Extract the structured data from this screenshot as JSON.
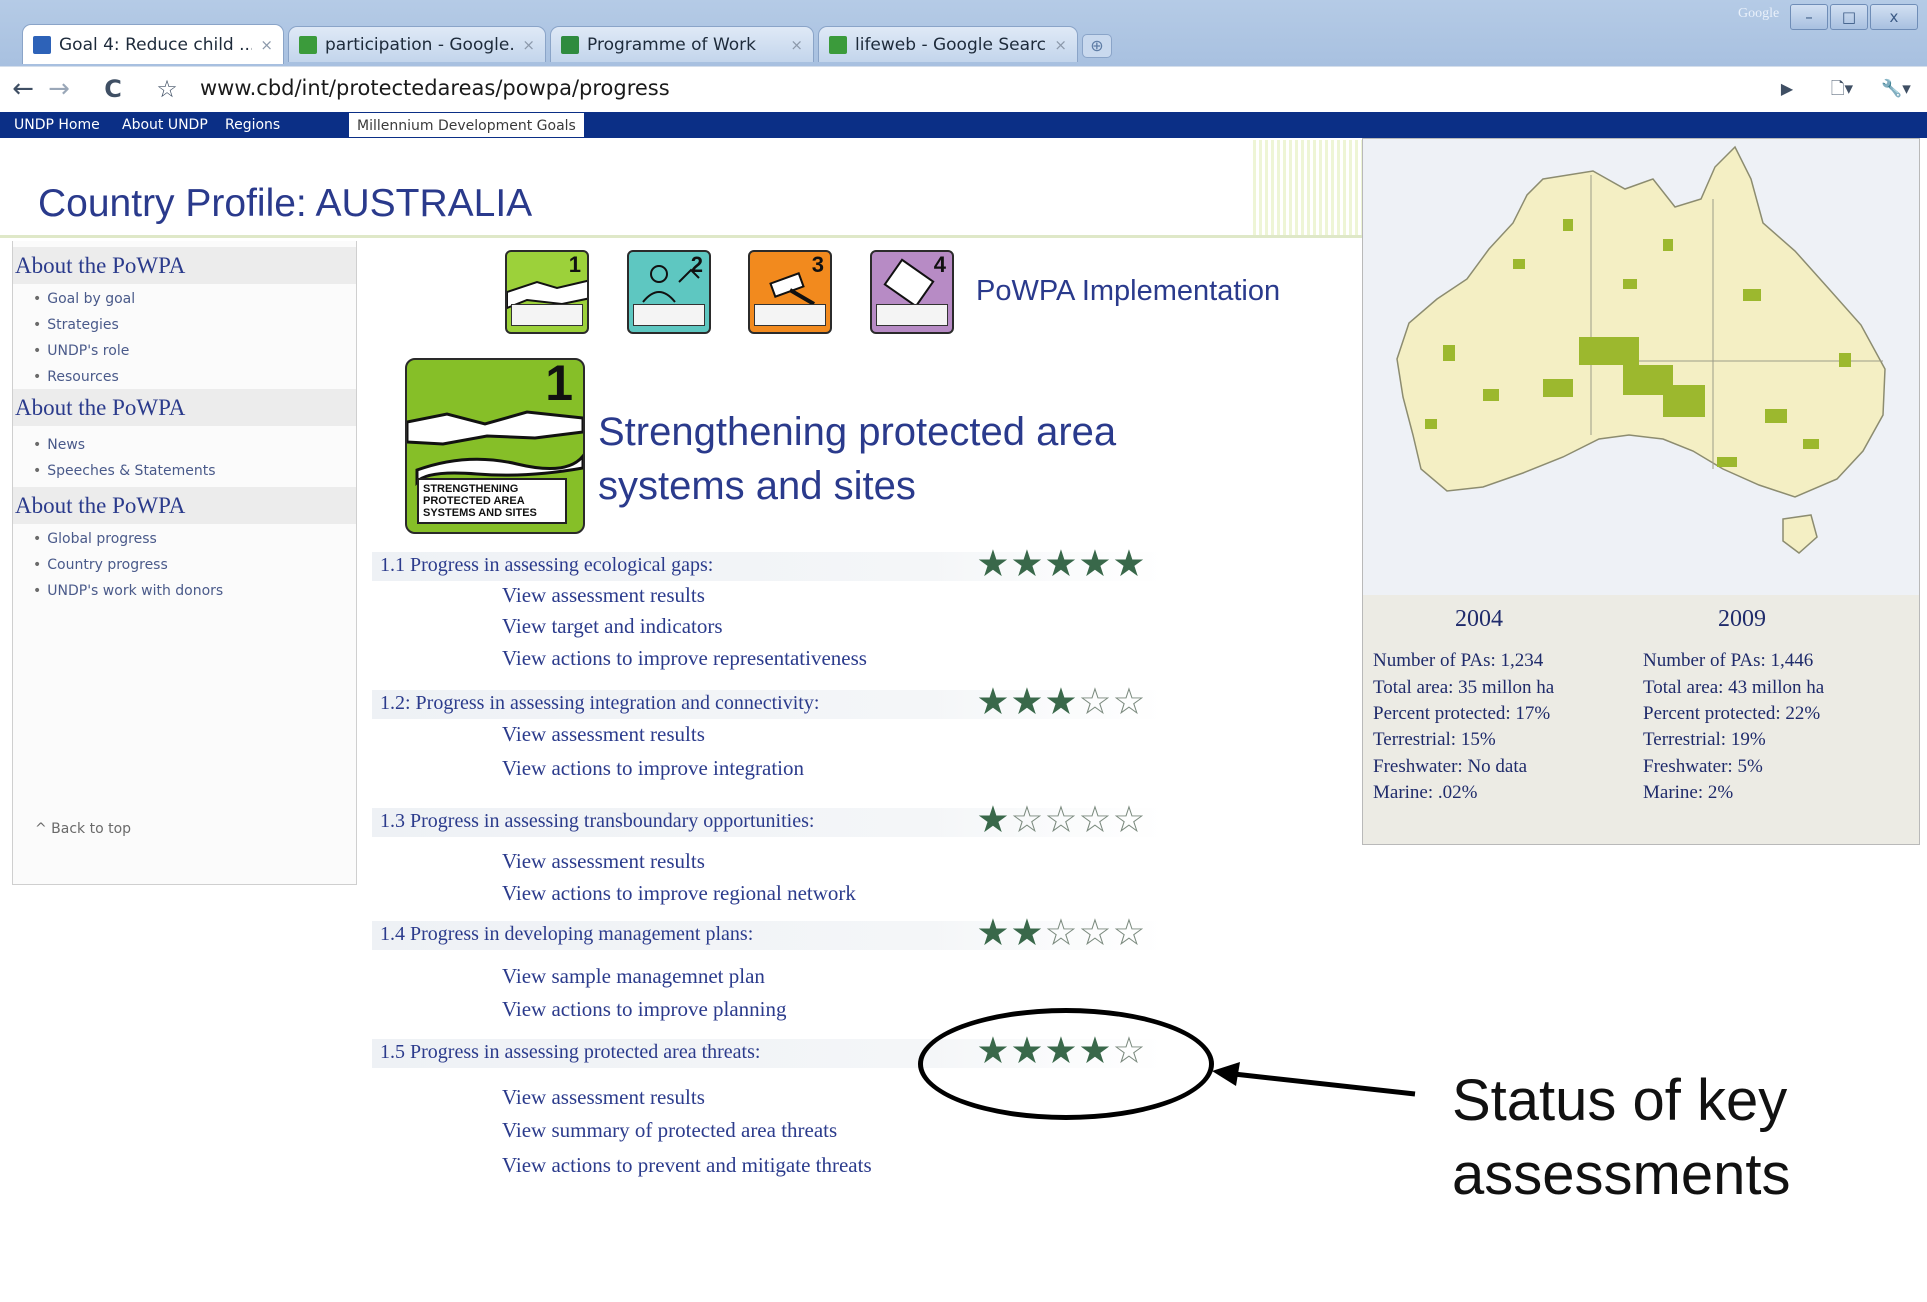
{
  "browser": {
    "tabs": [
      {
        "title": "Goal 4: Reduce child ...",
        "close": "×",
        "favicon_color": "#2d62b8"
      },
      {
        "title": "participation - Google...",
        "close": "×",
        "favicon_color": "#3b9b3b"
      },
      {
        "title": "Programme of Work",
        "close": "×",
        "favicon_color": "#2f8b3f"
      },
      {
        "title": "lifeweb - Google Search",
        "close": "×",
        "favicon_color": "#3b9b3b"
      }
    ],
    "new_tab": "⊕",
    "corner_text": "Google",
    "window_buttons": [
      "–",
      "□",
      "x"
    ],
    "url": "www.cbd/int/protectedareas/powpa/progress",
    "nav": {
      "back": "←",
      "forward": "→",
      "reload": "C",
      "bookmark": "☆",
      "play": "▶",
      "page": "🗋▾",
      "tools": "🔧▾"
    }
  },
  "site_nav": {
    "items": [
      "UNDP Home",
      "About UNDP",
      "Regions"
    ],
    "active": "Millennium Development Goals"
  },
  "page": {
    "title": "Country Profile: AUSTRALIA",
    "goal_icons": [
      {
        "number": "1",
        "color": "#9cd13a"
      },
      {
        "number": "2",
        "color": "#5ec7c1"
      },
      {
        "number": "3",
        "color": "#f28a1e"
      },
      {
        "number": "4",
        "color": "#b78bc5"
      }
    ],
    "implementation_label": "PoWPA Implementation",
    "big_goal": {
      "number": "1",
      "caption": "STRENGTHENING PROTECTED AREA SYSTEMS AND SITES"
    },
    "goal_heading": "Strengthening protected area systems and sites"
  },
  "sidebar": {
    "sections": [
      {
        "heading": "About the PoWPA",
        "links": [
          "Goal by goal",
          "Strategies",
          "UNDP's role",
          "Resources"
        ]
      },
      {
        "heading": "About the PoWPA",
        "links": [
          "News",
          "Speeches & Statements"
        ]
      },
      {
        "heading": "About the PoWPA",
        "links": [
          "Global progress",
          "Country progress",
          "UNDP's work with donors"
        ]
      }
    ],
    "back_to_top": "^ Back to top"
  },
  "progress": [
    {
      "label": "1.1 Progress in assessing ecological gaps:",
      "rating": 5,
      "max": 5,
      "links": [
        "View assessment results",
        "View target and indicators",
        "View actions to improve representativeness"
      ]
    },
    {
      "label": "1.2: Progress in assessing integration and connectivity:",
      "rating": 3,
      "max": 5,
      "links": [
        "View assessment results",
        "View actions to improve integration"
      ]
    },
    {
      "label": "1.3 Progress in assessing transboundary opportunities:",
      "rating": 1,
      "max": 5,
      "links": [
        "View assessment results",
        "View actions to improve regional network"
      ]
    },
    {
      "label": "1.4 Progress in developing management plans:",
      "rating": 2,
      "max": 5,
      "links": [
        "View sample managemnet plan",
        "View actions to improve planning"
      ]
    },
    {
      "label": "1.5 Progress in assessing protected area threats:",
      "rating": 4,
      "max": 5,
      "links": [
        "View assessment results",
        "View summary of protected area threats",
        "View actions to prevent and mitigate threats"
      ]
    }
  ],
  "stats": {
    "years": [
      {
        "year": "2004",
        "lines": [
          "Number of PAs: 1,234",
          "Total area: 35 millon ha",
          "Percent protected: 17%",
          "Terrestrial: 15%",
          "Freshwater: No data",
          "Marine: .02%"
        ]
      },
      {
        "year": "2009",
        "lines": [
          "Number of PAs: 1,446",
          "Total area: 43 millon ha",
          "Percent protected: 22%",
          "Terrestrial: 19%",
          "Freshwater: 5%",
          "Marine: 2%"
        ]
      }
    ]
  },
  "annotation": {
    "text": "Status of key assessments"
  },
  "colors": {
    "nav_blue": "#0b2f86",
    "title_blue": "#2a3a8c",
    "star_green": "#39684a",
    "map_land": "#f4efc4",
    "map_pa": "#9cb82e"
  }
}
